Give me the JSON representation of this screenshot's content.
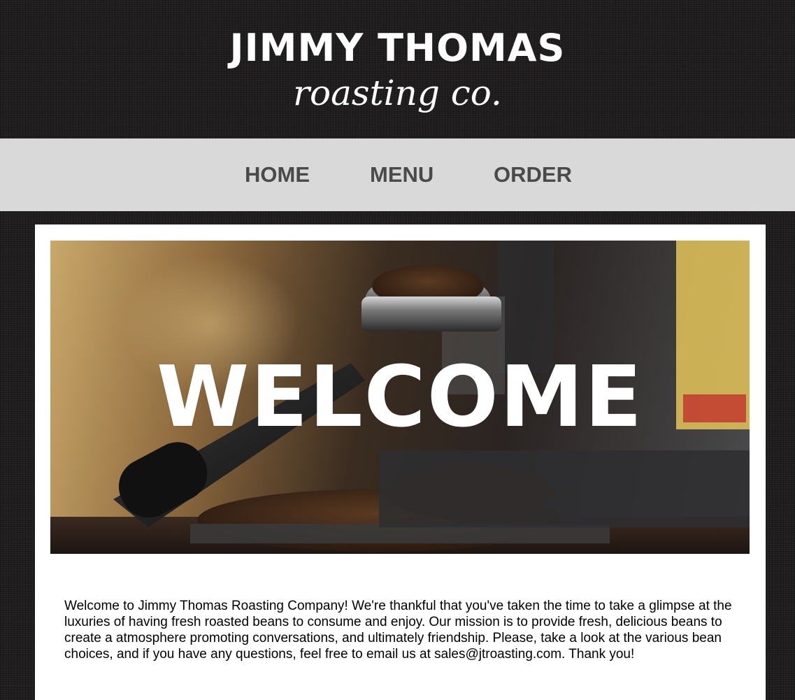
{
  "header": {
    "brand_name": "JIMMY THOMAS",
    "brand_tagline": "roasting co."
  },
  "nav": {
    "items": [
      {
        "label": "HOME"
      },
      {
        "label": "MENU"
      },
      {
        "label": "ORDER"
      }
    ]
  },
  "hero": {
    "text": "WELCOME"
  },
  "intro": {
    "text": "Welcome to Jimmy Thomas Roasting Company! We're thankful that you've taken the time to take a glimpse at the luxuries of having fresh roasted beans to consume and enjoy. Our mission is to provide fresh, delicious beans to create a atmosphere promoting conversations, and ultimately friendship. Please, take a look at the various bean choices, and if you have any questions, feel free to email us at sales@jtroasting.com. Thank you!"
  },
  "colors": {
    "page_background": "#1f1d1d",
    "nav_background": "#d9d9d9",
    "nav_text": "#4a4a4a",
    "content_background": "#ffffff"
  }
}
